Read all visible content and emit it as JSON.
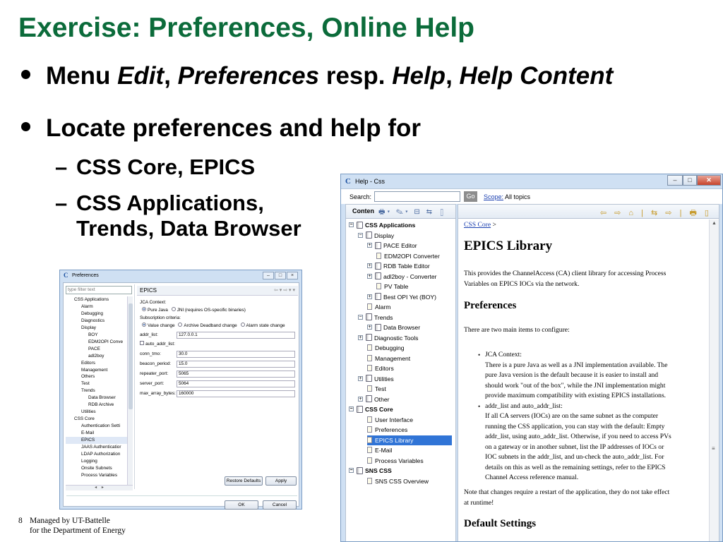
{
  "slide": {
    "title": "Exercise: Preferences, Online Help",
    "bullet1": {
      "prefix": "Menu ",
      "edit": "Edit",
      "comma1": ", ",
      "preferences": "Preferences",
      "resp": " resp. ",
      "help": "Help",
      "comma2": ", ",
      "help_content": "Help Content"
    },
    "bullet2": "Locate preferences and help for",
    "sub1": "CSS Core, EPICS",
    "sub2_line1": "CSS Applications,",
    "sub2_line2": "Trends, Data Browser",
    "dash": "–",
    "footer": {
      "page": "8",
      "line1": "Managed by UT-Battelle",
      "line2": "for the Department of Energy"
    }
  },
  "preferences_dialog": {
    "title": "Preferences",
    "filter_placeholder": "type filter text",
    "tree": [
      "CSS Applications",
      "Alarm",
      "Debugging",
      "Diagnostics",
      "Display",
      "BOY",
      "EDM2OPI Conve",
      "PACE",
      "adl2boy",
      "Editors",
      "Management",
      "Others",
      "Test",
      "Trends",
      "Data Browser",
      "RDB Archive",
      "Utilities",
      "CSS Core",
      "Authentication Setti",
      "E-Mail",
      "EPICS",
      "JAAS Authenticatior",
      "LDAP Authorization",
      "Logging",
      "Onsite Subnets",
      "Process Variables"
    ],
    "tree_indent": [
      0,
      1,
      1,
      1,
      1,
      2,
      2,
      2,
      2,
      1,
      1,
      1,
      1,
      1,
      2,
      2,
      1,
      0,
      1,
      1,
      1,
      1,
      1,
      1,
      1,
      1
    ],
    "page_title": "EPICS",
    "nav_icons": "⇦ ▾ ⇨ ▾ ▾",
    "jca_context_label": "JCA Context:",
    "jca_options": [
      "Pure Java",
      "JNI (requires OS-specific binaries)"
    ],
    "subscription_label": "Subscription criteria:",
    "subscription_options": [
      "Value change",
      "Archive Deadband change",
      "Alarm state change"
    ],
    "fields": [
      {
        "label": "addr_list:",
        "value": "127.0.0.1"
      },
      {
        "label": "auto_addr_list:",
        "value": ""
      },
      {
        "label": "conn_tmo:",
        "value": "30.0"
      },
      {
        "label": "beacon_period:",
        "value": "15.0"
      },
      {
        "label": "repeater_port:",
        "value": "5065"
      },
      {
        "label": "server_port:",
        "value": "5064"
      },
      {
        "label": "max_array_bytes:",
        "value": "160000"
      }
    ],
    "restore_defaults": "Restore Defaults",
    "apply": "Apply",
    "ok": "OK",
    "cancel": "Cancel"
  },
  "help_window": {
    "title": "Help - Css",
    "search_label": "Search:",
    "go": "Go",
    "scope_link": "Scope:",
    "scope_value": "All topics",
    "contents_tab": "Conten",
    "tree": [
      {
        "label": "CSS Applications",
        "level": 0,
        "icon": "book",
        "expander": "⊟",
        "bold": true
      },
      {
        "label": "Display",
        "level": 1,
        "icon": "book",
        "expander": "⊟"
      },
      {
        "label": "PACE Editor",
        "level": 2,
        "icon": "book",
        "expander": "⊞"
      },
      {
        "label": "EDM2OPI Converter",
        "level": 2,
        "icon": "page"
      },
      {
        "label": "RDB Table Editor",
        "level": 2,
        "icon": "book",
        "expander": "⊞"
      },
      {
        "label": "adl2boy - Converter",
        "level": 2,
        "icon": "book",
        "expander": "⊞"
      },
      {
        "label": "PV Table",
        "level": 2,
        "icon": "page"
      },
      {
        "label": "Best OPI Yet (BOY)",
        "level": 2,
        "icon": "book",
        "expander": "⊞"
      },
      {
        "label": "Alarm",
        "level": 1,
        "icon": "page"
      },
      {
        "label": "Trends",
        "level": 1,
        "icon": "book",
        "expander": "⊟"
      },
      {
        "label": "Data Browser",
        "level": 2,
        "icon": "book",
        "expander": "⊞"
      },
      {
        "label": "Diagnostic Tools",
        "level": 1,
        "icon": "book",
        "expander": "⊞"
      },
      {
        "label": "Debugging",
        "level": 1,
        "icon": "page"
      },
      {
        "label": "Management",
        "level": 1,
        "icon": "page"
      },
      {
        "label": "Editors",
        "level": 1,
        "icon": "page"
      },
      {
        "label": "Utilities",
        "level": 1,
        "icon": "book",
        "expander": "⊞"
      },
      {
        "label": "Test",
        "level": 1,
        "icon": "page"
      },
      {
        "label": "Other",
        "level": 1,
        "icon": "book",
        "expander": "⊞"
      },
      {
        "label": "CSS Core",
        "level": 0,
        "icon": "book",
        "expander": "⊟",
        "bold": true
      },
      {
        "label": "User Interface",
        "level": 1,
        "icon": "page"
      },
      {
        "label": "Preferences",
        "level": 1,
        "icon": "page"
      },
      {
        "label": "EPICS Library",
        "level": 1,
        "icon": "page",
        "selected": true
      },
      {
        "label": "E-Mail",
        "level": 1,
        "icon": "page"
      },
      {
        "label": "Process Variables",
        "level": 1,
        "icon": "page"
      },
      {
        "label": "SNS CSS",
        "level": 0,
        "icon": "book",
        "expander": "⊟",
        "bold": true
      },
      {
        "label": "SNS CSS Overview",
        "level": 1,
        "icon": "page"
      }
    ],
    "doc": {
      "breadcrumb_link": "CSS Core",
      "breadcrumb_sep": " >",
      "heading": "EPICS Library",
      "intro": [
        "This provides the ChannelAccess (CA) client library for accessing Process",
        "Variables on EPICS IOCs via the network."
      ],
      "preferences_heading": "Preferences",
      "pref_intro": "There are two main items to configure:",
      "items": [
        [
          "JCA Context:",
          "There is a pure Java as well as a JNI implementation available. The",
          "pure Java version is the default because it is easier to install and",
          "should work \"out of the box\", while the JNI implementation might",
          "provide maximum compatibility with existing EPICS installations."
        ],
        [
          "addr_list and auto_addr_list:",
          "If all CA servers (IOCs) are on the same subnet as the computer",
          "running the CSS application, you can stay with the default: Empty",
          "addr_list, using auto_addr_list. Otherwise, if you need to access PVs",
          "on a gateway or in another subnet, list the IP addresses of IOCs or",
          "IOC subnets in the addr_list, and un-check the auto_addr_list. For",
          "details on this as well as the remaining settings, refer to the EPICS",
          "Channel Access reference manual."
        ]
      ],
      "note": [
        "Note that changes require a restart of the application, they do not take effect",
        "at runtime!"
      ],
      "default_heading": "Default Settings"
    }
  }
}
